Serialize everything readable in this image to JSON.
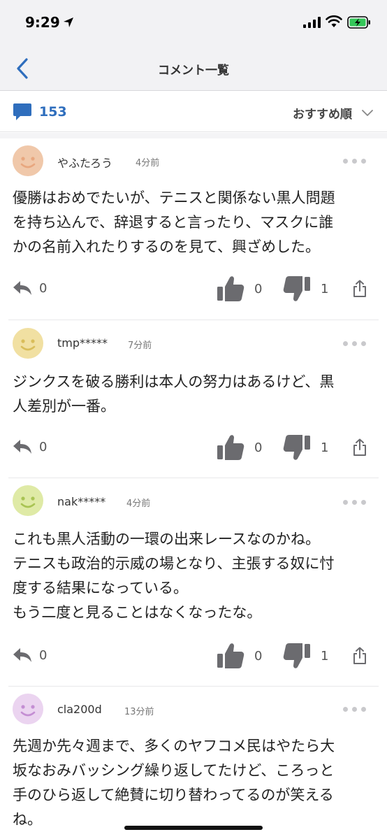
{
  "status_bar": {
    "time": "9:29"
  },
  "nav": {
    "title": "コメント一覧"
  },
  "sort_bar": {
    "count": "153",
    "sort_label": "おすすめ順"
  },
  "comments": [
    {
      "user": "やふたろう",
      "time": "4分前",
      "avatar_color": "#f0c8aa",
      "face_color": "#e8a77f",
      "body": "優勝はおめでたいが、テニスと関係ない黒人問題\nを持ち込んで、辞退すると言ったり、マスクに誰\nかの名前入れたりするのを見て、興ざめした。",
      "reply_count": "0",
      "like_count": "0",
      "dislike_count": "1"
    },
    {
      "user": "tmp*****",
      "time": "7分前",
      "avatar_color": "#f1e0a2",
      "face_color": "#d9bd5a",
      "body": "ジンクスを破る勝利は本人の努力はあるけど、黒\n人差別が一番。",
      "reply_count": "0",
      "like_count": "0",
      "dislike_count": "1"
    },
    {
      "user": "nak*****",
      "time": "4分前",
      "avatar_color": "#dfeaa6",
      "face_color": "#a9c453",
      "body": "これも黒人活動の一環の出来レースなのかね。\nテニスも政治的示威の場となり、主張する奴に忖\n度する結果になっている。\nもう二度と見ることはなくなったな。",
      "reply_count": "0",
      "like_count": "0",
      "dislike_count": "1"
    },
    {
      "user": "cla200d",
      "time": "13分前",
      "avatar_color": "#ebd4f0",
      "face_color": "#c48ed3",
      "body": "先週か先々週まで、多くのヤフコメ民はやたら大\n坂なおみバッシング繰り返してたけど、ころっと\n手のひら返して絶賛に切り替わってるのが笑える\nね。"
    }
  ],
  "colors": {
    "accent": "#2f6ebd",
    "icon_gray": "#6b6b6f"
  }
}
